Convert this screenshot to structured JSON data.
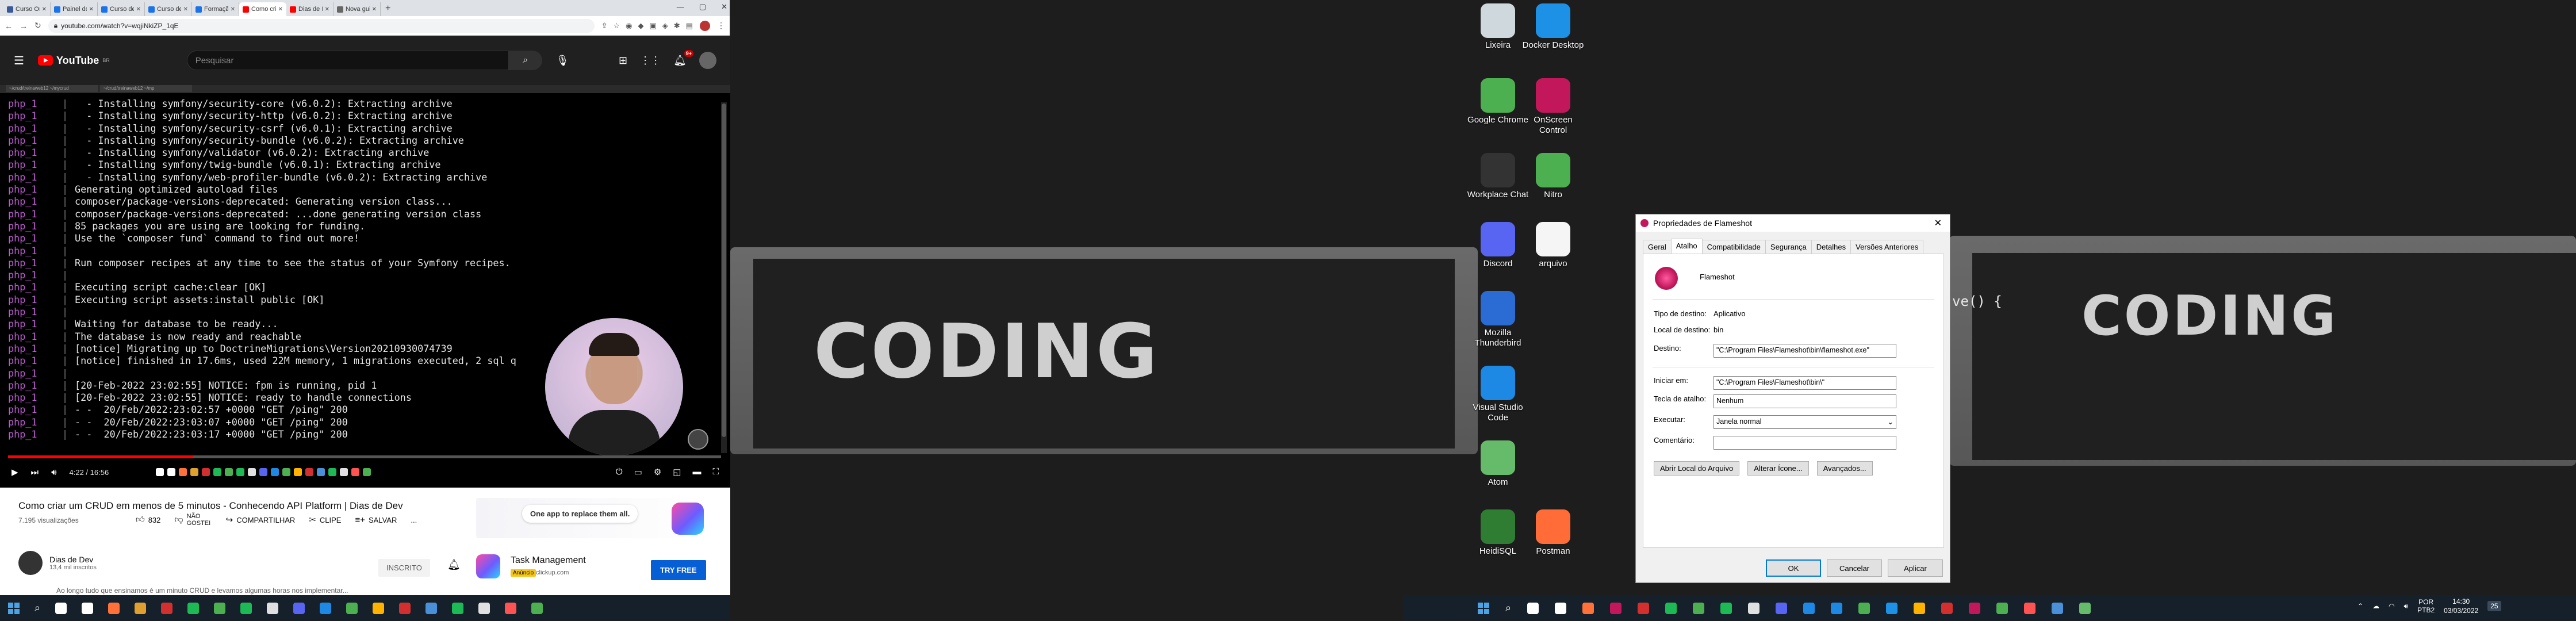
{
  "browser": {
    "tabs": [
      {
        "label": "Curso Onl",
        "color": "#3b5998"
      },
      {
        "label": "Painel do",
        "color": "#1a73e8"
      },
      {
        "label": "Curso de",
        "color": "#1a73e8"
      },
      {
        "label": "Curso de",
        "color": "#1a73e8"
      },
      {
        "label": "Formação",
        "color": "#1a73e8"
      },
      {
        "label": "Como cria",
        "color": "#ff0000",
        "active": true
      },
      {
        "label": "Dias de De",
        "color": "#ff0000"
      },
      {
        "label": "Nova guia",
        "color": "#666666"
      }
    ],
    "new_tab": "+",
    "url": "youtube.com/watch?v=wqjiNkiZP_1qE"
  },
  "youtube": {
    "logo": "YouTube",
    "logo_sup": "BR",
    "search_placeholder": "Pesquisar",
    "notif_count": "9+",
    "video_title": "Como criar um CRUD em menos de 5 minutos - Conhecendo API Platform | Dias de Dev",
    "views": "7.195 visualizações",
    "likes": "832",
    "dislike": "NÃO GOSTEI",
    "share": "COMPARTILHAR",
    "clip": "CLIPE",
    "save": "SALVAR",
    "more": "...",
    "channel_name": "Dias de Dev",
    "subscribers": "13,4 mil inscritos",
    "subscribed": "INSCRITO",
    "description": "Ao longo tudo que ensinamos é um minuto CRUD e levamos algumas horas nos implementar...",
    "time": "4:22 / 16:56",
    "progress_fraction": 0.26,
    "mini_tabs": [
      "~/crud/treinaweb12 ~/mycrud",
      "~/crud/treinaweb12 ~/mp"
    ]
  },
  "terminal": {
    "prefix": "php_1",
    "lines": [
      "  - Installing symfony/security-core (v6.0.2): Extracting archive",
      "  - Installing symfony/security-http (v6.0.2): Extracting archive",
      "  - Installing symfony/security-csrf (v6.0.1): Extracting archive",
      "  - Installing symfony/security-bundle (v6.0.2): Extracting archive",
      "  - Installing symfony/validator (v6.0.2): Extracting archive",
      "  - Installing symfony/twig-bundle (v6.0.1): Extracting archive",
      "  - Installing symfony/web-profiler-bundle (v6.0.2): Extracting archive",
      "Generating optimized autoload files",
      "composer/package-versions-deprecated: Generating version class...",
      "composer/package-versions-deprecated: ...done generating version class",
      "85 packages you are using are looking for funding.",
      "Use the `composer fund` command to find out more!",
      "",
      "Run composer recipes at any time to see the status of your Symfony recipes.",
      "",
      "Executing script cache:clear [OK]",
      "Executing script assets:install public [OK]",
      "",
      "Waiting for database to be ready...",
      "The database is now ready and reachable",
      "[notice] Migrating up to DoctrineMigrations\\Version20210930074739",
      "[notice] finished in 17.6ms, used 22M memory, 1 migrations executed, 2 sql q",
      "",
      "[20-Feb-2022 23:02:55] NOTICE: fpm is running, pid 1",
      "[20-Feb-2022 23:02:55] NOTICE: ready to handle connections",
      "- -  20/Feb/2022:23:02:57 +0000 \"GET /ping\" 200",
      "- -  20/Feb/2022:23:03:07 +0000 \"GET /ping\" 200",
      "- -  20/Feb/2022:23:03:17 +0000 \"GET /ping\" 200"
    ]
  },
  "ad": {
    "bubble": "One app to replace them all.",
    "title": "Task Management",
    "tag": "Anúncio",
    "url": "clickup.com",
    "cta": "TRY FREE"
  },
  "desktop": {
    "wallpaper_text": "CODING",
    "snippet": "ve() {",
    "icons_col1": [
      {
        "label": "Lixeira",
        "color": "#cfd8dc"
      },
      {
        "label": "Google Chrome",
        "color": "#4caf50"
      },
      {
        "label": "Workplace Chat",
        "color": "#333333"
      },
      {
        "label": "Discord",
        "color": "#5865f2"
      },
      {
        "label": "Mozilla Thunderbird",
        "color": "#2a6bd4"
      },
      {
        "label": "Visual Studio Code",
        "color": "#1e88e5"
      },
      {
        "label": "Atom",
        "color": "#66bb6a"
      },
      {
        "label": "HeidiSQL",
        "color": "#2e7d32"
      }
    ],
    "icons_col2": [
      {
        "label": "Docker Desktop",
        "color": "#1d91e6"
      },
      {
        "label": "OnScreen Control",
        "color": "#c2185b"
      },
      {
        "label": "Nitro",
        "color": "#4caf50"
      },
      {
        "label": "arquivo",
        "color": "#f5f5f5"
      },
      {
        "label": "Postman",
        "color": "#ff6c37"
      }
    ]
  },
  "dialog": {
    "title": "Propriedades de Flameshot",
    "tabs": [
      "Geral",
      "Atalho",
      "Compatibilidade",
      "Segurança",
      "Detalhes",
      "Versões Anteriores"
    ],
    "active_tab": "Atalho",
    "app_name": "Flameshot",
    "tipo_label": "Tipo de destino:",
    "tipo_value": "Aplicativo",
    "local_label": "Local de destino:",
    "local_value": "bin",
    "destino_label": "Destino:",
    "destino_value": "\"C:\\Program Files\\Flameshot\\bin\\flameshot.exe\"",
    "iniciar_label": "Iniciar em:",
    "iniciar_value": "\"C:\\Program Files\\Flameshot\\bin\\\"",
    "tecla_label": "Tecla de atalho:",
    "tecla_value": "Nenhum",
    "executar_label": "Executar:",
    "executar_value": "Janela normal",
    "comentario_label": "Comentário:",
    "comentario_value": "",
    "btn_abrir": "Abrir Local do Arquivo",
    "btn_alterar": "Alterar Ícone...",
    "btn_avancados": "Avançados...",
    "ok": "OK",
    "cancelar": "Cancelar",
    "aplicar": "Aplicar"
  },
  "taskbar": {
    "clock_time": "14:30",
    "clock_date": "03/03/2022",
    "lang_top": "POR",
    "lang_bottom": "PTB2",
    "notif_count": "25",
    "icons_left": [
      "#ffffff",
      "#ffffff",
      "#ff7139",
      "#e0a030",
      "#d32f2f",
      "#1db954",
      "#4caf50",
      "#1db954",
      "#e0e0e0",
      "#5865f2",
      "#1e88e5",
      "#4caf50",
      "#ffb300",
      "#d32f2f",
      "#4a90d9",
      "#1db954",
      "#e0e0e0",
      "#ff5252",
      "#4caf50"
    ],
    "icons_right": [
      "#ffffff",
      "#ffffff",
      "#ff7139",
      "#c2185b",
      "#d32f2f",
      "#1db954",
      "#4caf50",
      "#1db954",
      "#e0e0e0",
      "#5865f2",
      "#1e88e5",
      "#1e88e5",
      "#4caf50",
      "#1d91e6",
      "#ffb300",
      "#d32f2f",
      "#c2185b",
      "#4caf50",
      "#ff5252",
      "#4a90d9",
      "#66bb6a"
    ]
  }
}
